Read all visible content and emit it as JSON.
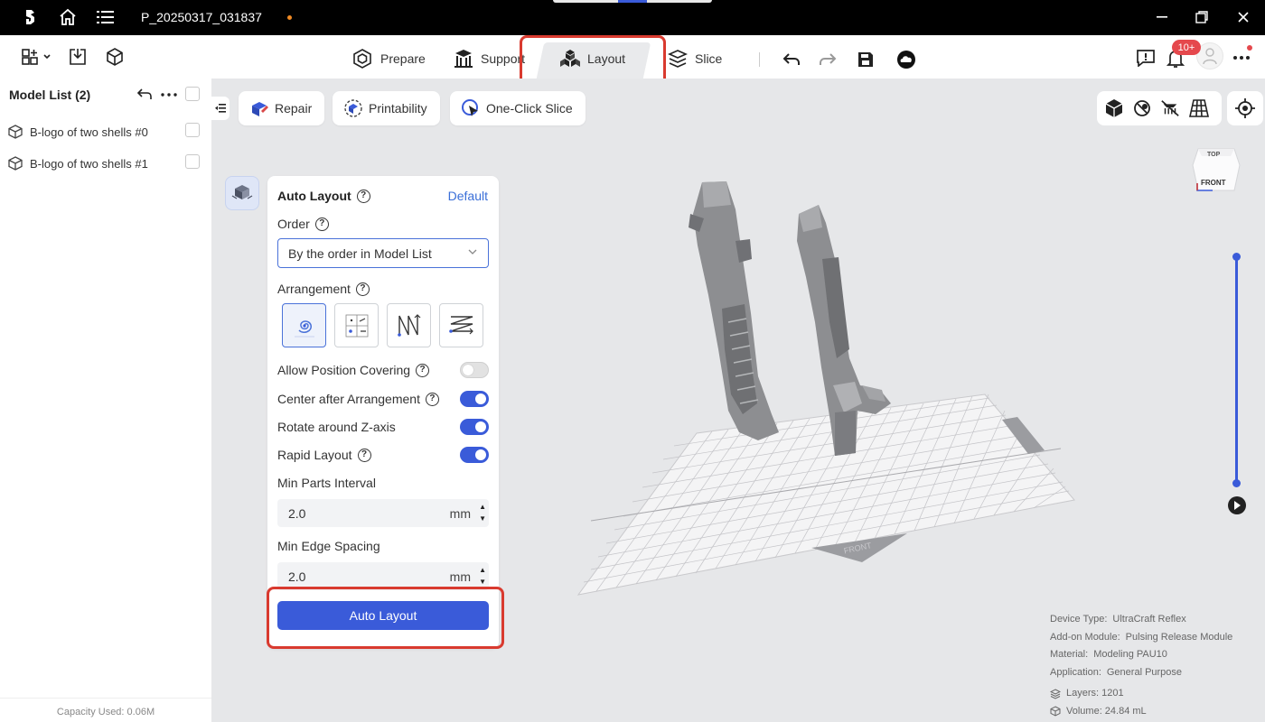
{
  "titlebar": {
    "project_name": "P_20250317_031837",
    "icons": [
      "bambu-logo-icon",
      "home-icon",
      "menu-icon",
      "minimize-icon",
      "restore-icon",
      "close-icon"
    ]
  },
  "toolbar": {
    "tabs": [
      {
        "label": "Prepare",
        "icon": "prepare-icon"
      },
      {
        "label": "Support",
        "icon": "support-icon"
      },
      {
        "label": "Layout",
        "icon": "layout-icon",
        "active": true
      },
      {
        "label": "Slice",
        "icon": "slice-icon"
      }
    ],
    "notification_count": "10+",
    "left_icons": [
      "add-model-icon",
      "import-icon",
      "object-icon"
    ],
    "right_icons": [
      "undo-icon",
      "redo-icon",
      "save-icon",
      "cloud-icon",
      "feedback-icon",
      "bell-icon",
      "avatar",
      "more-icon"
    ]
  },
  "model_list": {
    "title": "Model List (2)",
    "items": [
      {
        "name": "B-logo of two shells #0"
      },
      {
        "name": "B-logo of two shells #1"
      }
    ],
    "capacity": "Capacity Used: 0.06M"
  },
  "viewport_tools": {
    "repair": "Repair",
    "printability": "Printability",
    "one_click_slice": "One-Click Slice",
    "view_cube_top": "TOP",
    "view_cube_front": "FRONT",
    "plate_label": "FRONT"
  },
  "auto_layout": {
    "title": "Auto Layout",
    "default_link": "Default",
    "order_label": "Order",
    "order_value": "By the order in Model List",
    "arrangement_label": "Arrangement",
    "arrangement_options": [
      "spiral",
      "grid",
      "zigzag-vertical",
      "zigzag-horizontal"
    ],
    "options": [
      {
        "label": "Allow Position Covering",
        "help": true,
        "on": false
      },
      {
        "label": "Center after Arrangement",
        "help": true,
        "on": true
      },
      {
        "label": "Rotate around Z-axis",
        "help": false,
        "on": true
      },
      {
        "label": "Rapid Layout",
        "help": true,
        "on": true
      }
    ],
    "min_parts_interval_label": "Min Parts Interval",
    "min_parts_interval_value": "2.0",
    "min_edge_spacing_label": "Min Edge Spacing",
    "min_edge_spacing_value": "2.0",
    "unit": "mm",
    "button": "Auto Layout"
  },
  "info": {
    "device_type_label": "Device Type:",
    "device_type": "UltraCraft Reflex",
    "addon_label": "Add-on Module:",
    "addon": "Pulsing Release Module",
    "material_label": "Material:",
    "material": "Modeling PAU10",
    "application_label": "Application:",
    "application": "General Purpose",
    "layers": "Layers: 1201",
    "volume": "Volume: 24.84 mL"
  },
  "colors": {
    "accent": "#3a5bd9",
    "highlight": "#d93a2f",
    "badge": "#e5484d"
  }
}
